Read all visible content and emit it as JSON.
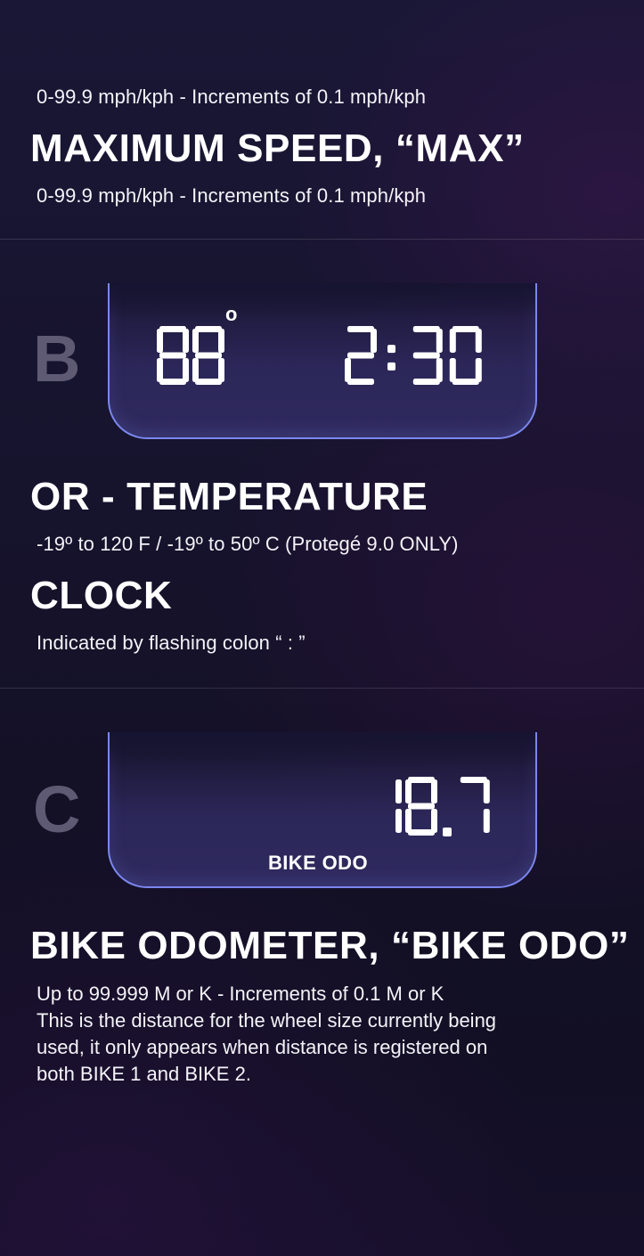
{
  "top_section": {
    "range_line_1": "0-99.9 mph/kph   -   Increments of 0.1 mph/kph",
    "max_heading": "MAXIMUM SPEED, “MAX”",
    "range_line_2": "0-99.9 mph/kph   -   Increments of 0.1 mph/kph"
  },
  "section_b": {
    "letter": "B",
    "display": {
      "temperature": "88",
      "degree_symbol": "o",
      "clock": "2:30"
    },
    "temperature_heading": "OR - TEMPERATURE",
    "temperature_range": "-19º to 120 F / -19º to 50º C   (Protegé 9.0 ONLY)",
    "clock_heading": "CLOCK",
    "clock_note": "Indicated by flashing colon “ : ”"
  },
  "section_c": {
    "letter": "C",
    "display": {
      "odometer_value": "18.7",
      "label": "BIKE ODO"
    },
    "heading": "BIKE ODOMETER, “BIKE ODO”",
    "range_line": "Up to 99.999 M or K   -   Increments of 0.1 M or K",
    "description": [
      "This is the distance for the wheel size currently being",
      "used, it only appears when distance is registered on",
      "both BIKE 1 and BIKE 2."
    ]
  },
  "colors": {
    "display_border": "#7b87ee",
    "display_fill": "#2f2a5e",
    "section_letter": "#5f5a73",
    "text": "#ffffff"
  }
}
